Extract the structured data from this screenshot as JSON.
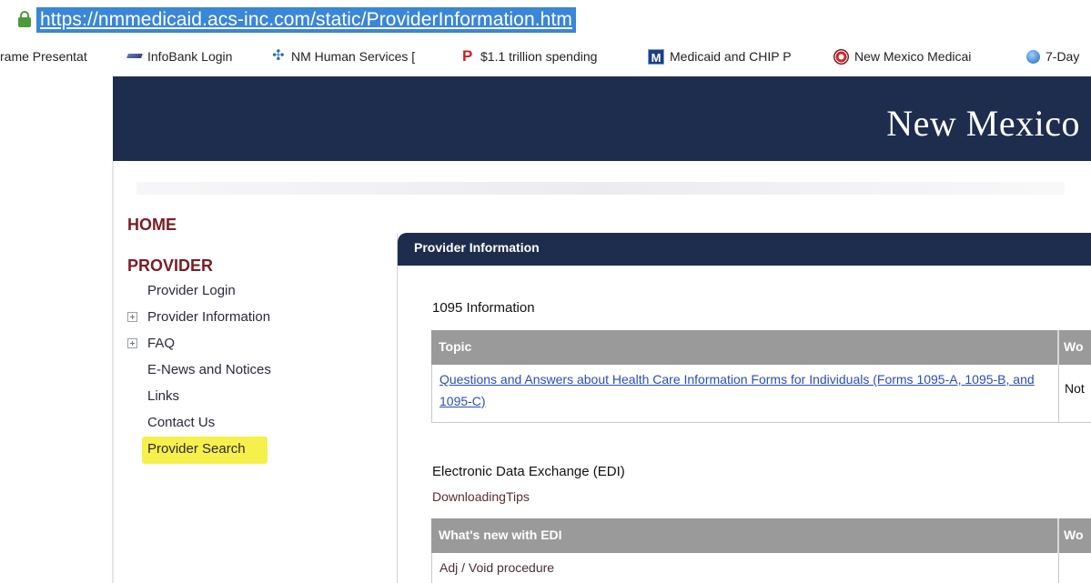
{
  "browser": {
    "url": "https://nmmedicaid.acs-inc.com/static/ProviderInformation.htm",
    "bookmarks": [
      {
        "label": "rame Presentat",
        "icon": "none"
      },
      {
        "label": "InfoBank Login",
        "icon": "plane-icon"
      },
      {
        "label": "NM Human Services [",
        "icon": "star-icon"
      },
      {
        "label": "$1.1 trillion spending",
        "icon": "p-logo-icon"
      },
      {
        "label": "Medicaid and CHIP P",
        "icon": "m-logo-icon"
      },
      {
        "label": "New Mexico Medicai",
        "icon": "seal-icon"
      },
      {
        "label": "7-Day",
        "icon": "globe-icon"
      }
    ]
  },
  "header": {
    "title": "New Mexico"
  },
  "nav": {
    "home": "HOME",
    "provider": "PROVIDER",
    "items": [
      {
        "label": "Provider Login",
        "expandable": false
      },
      {
        "label": "Provider Information",
        "expandable": true
      },
      {
        "label": "FAQ",
        "expandable": true
      },
      {
        "label": "E-News and Notices",
        "expandable": false
      },
      {
        "label": "Links",
        "expandable": false
      },
      {
        "label": "Contact Us",
        "expandable": false
      },
      {
        "label": "Provider Search",
        "expandable": false,
        "highlighted": true
      }
    ],
    "highlight_color": "#f6f14a"
  },
  "panel": {
    "title": "Provider Information",
    "section1": {
      "title": "1095 Information",
      "headers": [
        "Topic",
        "Wo"
      ],
      "rows": [
        {
          "topic": "Questions and Answers about Health Care Information Forms for Individuals (Forms 1095-A, 1095-B, and 1095-C)",
          "col2": "Not"
        }
      ]
    },
    "section2": {
      "title": "Electronic Data Exchange (EDI)",
      "tips_link": "DownloadingTips",
      "headers": [
        "What's new with EDI",
        "Wo"
      ],
      "rows": [
        {
          "topic": "Adj / Void procedure"
        }
      ]
    }
  },
  "colors": {
    "header_band": "#1e2d4d",
    "nav_heading": "#7a1d24",
    "table_header": "#9a9a9a",
    "link": "#2a4db8",
    "url_highlight": "#3a86d8"
  }
}
